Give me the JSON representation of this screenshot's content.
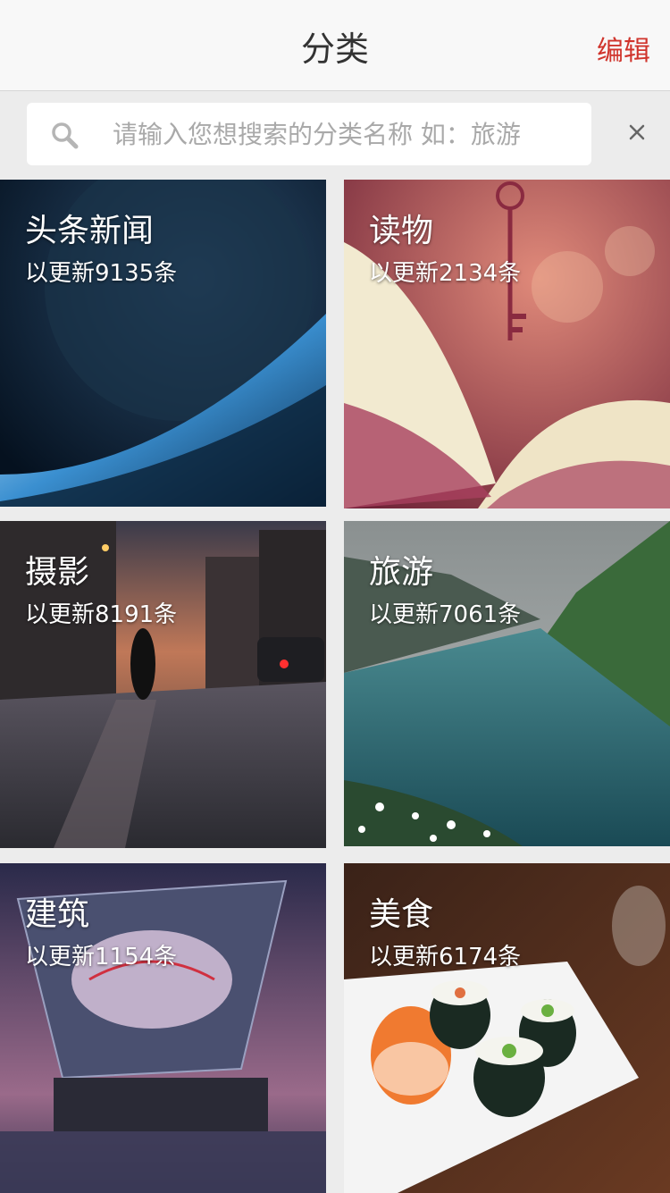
{
  "header": {
    "title": "分类",
    "edit_label": "编辑"
  },
  "search": {
    "placeholder": "请输入您想搜索的分类名称 如：旅游",
    "value": ""
  },
  "categories": [
    {
      "title": "头条新闻",
      "count_text": "以更新9135条",
      "theme": "space"
    },
    {
      "title": "读物",
      "count_text": "以更新2134条",
      "theme": "book"
    },
    {
      "title": "摄影",
      "count_text": "以更新8191条",
      "theme": "street"
    },
    {
      "title": "旅游",
      "count_text": "以更新7061条",
      "theme": "fjord"
    },
    {
      "title": "建筑",
      "count_text": "以更新1154条",
      "theme": "building"
    },
    {
      "title": "美食",
      "count_text": "以更新6174条",
      "theme": "sushi"
    }
  ],
  "colors": {
    "accent": "#d0342c",
    "header_bg": "#f8f8f8",
    "page_bg": "#ececec"
  }
}
